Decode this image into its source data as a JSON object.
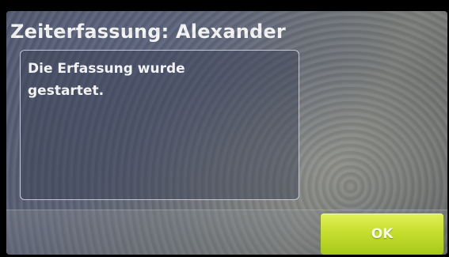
{
  "dialog": {
    "title": "Zeiterfassung: Alexander",
    "message_line_1": "Die Erfassung wurde",
    "message_line_2": "gestartet."
  },
  "buttons": {
    "ok_label": "OK"
  },
  "colors": {
    "title_text": "#f6f6f6",
    "ok_button_top": "#e2f05a",
    "ok_button_bottom": "#a6c81a"
  }
}
